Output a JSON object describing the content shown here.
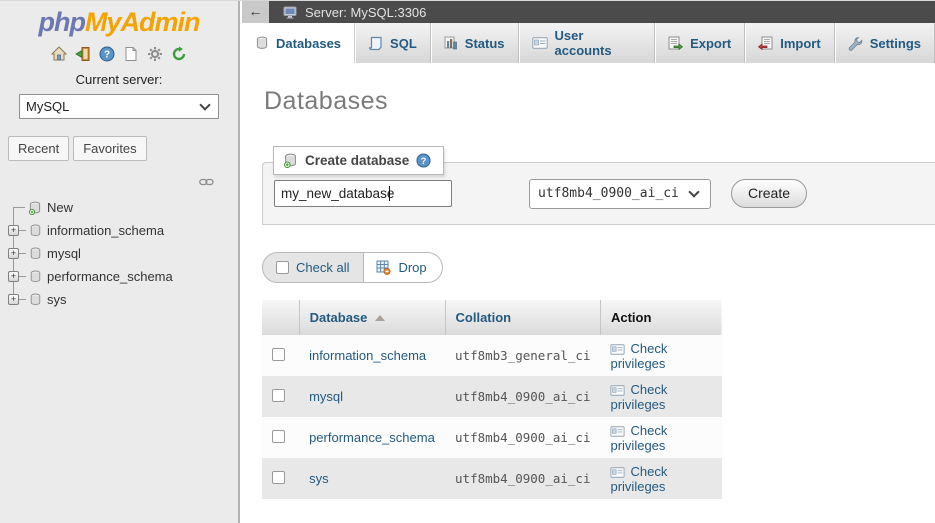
{
  "colors": {
    "accent_link": "#235a81",
    "logo_blue": "#6c78af",
    "logo_orange": "#f5a300",
    "topbar_bg": "#4b4b4b",
    "panel_bg": "#ebebeb",
    "row_alt_bg": "#e8e8e8"
  },
  "branding": {
    "logo_php": "php",
    "logo_myadmin": "MyAdmin",
    "quick_icons": [
      "home-icon",
      "logout-icon",
      "help-icon",
      "docs-icon",
      "settings-icon",
      "refresh-icon"
    ]
  },
  "nav": {
    "current_server_label": "Current server:",
    "server_select_value": "MySQL",
    "panel_tabs": [
      {
        "label": "Recent"
      },
      {
        "label": "Favorites"
      }
    ],
    "link_icon": "unlink-panel-icon",
    "tree": [
      {
        "label": "New",
        "type": "new-database"
      },
      {
        "label": "information_schema",
        "expandable": true
      },
      {
        "label": "mysql",
        "expandable": true
      },
      {
        "label": "performance_schema",
        "expandable": true
      },
      {
        "label": "sys",
        "expandable": true
      }
    ],
    "expander_glyph": "+"
  },
  "header": {
    "back_arrow": "←",
    "server_title": "Server: MySQL:3306"
  },
  "tabs": [
    {
      "label": "Databases",
      "icon": "database-icon",
      "active": true
    },
    {
      "label": "SQL",
      "icon": "sql-icon"
    },
    {
      "label": "Status",
      "icon": "status-chart-icon"
    },
    {
      "label": "User accounts",
      "icon": "user-accounts-icon"
    },
    {
      "label": "Export",
      "icon": "export-icon"
    },
    {
      "label": "Import",
      "icon": "import-icon"
    },
    {
      "label": "Settings",
      "icon": "settings-wrench-icon"
    }
  ],
  "main": {
    "page_title": "Databases",
    "create": {
      "legend": "Create database",
      "legend_icons": [
        "database-add-icon",
        "help-circle-icon"
      ],
      "name_value": "my_new_database",
      "collation_value": "utf8mb4_0900_ai_ci",
      "create_button": "Create"
    },
    "bulk": {
      "check_all": "Check all",
      "drop": "Drop",
      "drop_icon": "drop-table-icon"
    },
    "table": {
      "columns": [
        "Database",
        "Collation",
        "Action"
      ],
      "action_link": "Check privileges",
      "action_icon": "privileges-card-icon",
      "rows": [
        {
          "database": "information_schema",
          "collation": "utf8mb3_general_ci"
        },
        {
          "database": "mysql",
          "collation": "utf8mb4_0900_ai_ci"
        },
        {
          "database": "performance_schema",
          "collation": "utf8mb4_0900_ai_ci"
        },
        {
          "database": "sys",
          "collation": "utf8mb4_0900_ai_ci"
        }
      ]
    }
  }
}
